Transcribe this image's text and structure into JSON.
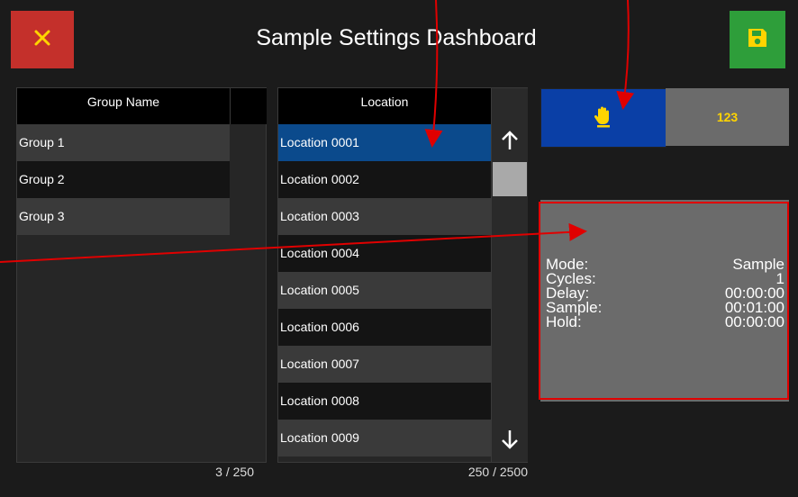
{
  "header": {
    "title": "Sample Settings Dashboard",
    "close_icon": "close-icon",
    "save_icon": "floppy-disk-icon",
    "close_color": "#c4302b",
    "save_color": "#2e9e3a"
  },
  "groups": {
    "header": "Group Name",
    "items": [
      {
        "label": "Group 1"
      },
      {
        "label": "Group 2"
      },
      {
        "label": "Group 3"
      }
    ],
    "count": "3 / 250"
  },
  "locations": {
    "header": "Location",
    "items": [
      {
        "label": "Location 0001",
        "selected": true
      },
      {
        "label": "Location 0002"
      },
      {
        "label": "Location 0003"
      },
      {
        "label": "Location 0004"
      },
      {
        "label": "Location 0005"
      },
      {
        "label": "Location 0006"
      },
      {
        "label": "Location 0007"
      },
      {
        "label": "Location 0008"
      },
      {
        "label": "Location 0009"
      }
    ],
    "count": "250 / 2500",
    "scroll_up_icon": "arrow-up-icon",
    "scroll_down_icon": "arrow-down-icon"
  },
  "mode_buttons": {
    "manual_icon": "hand-icon",
    "numeric_label": "123",
    "active_color": "#0a3fa6"
  },
  "info": {
    "rows": [
      {
        "label": "Mode:",
        "value": "Sample"
      },
      {
        "label": "Cycles:",
        "value": "1"
      },
      {
        "label": "Delay:",
        "value": "00:00:00"
      },
      {
        "label": "Sample:",
        "value": "00:01:00"
      },
      {
        "label": "Hold:",
        "value": "00:00:00"
      }
    ]
  }
}
